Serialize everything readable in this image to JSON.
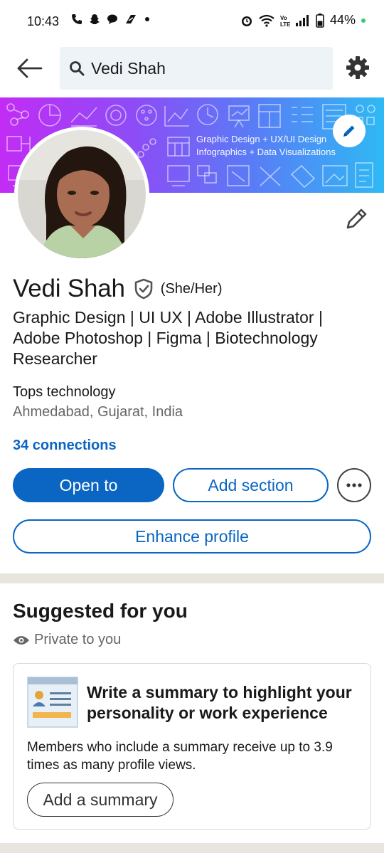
{
  "status_bar": {
    "time": "10:43",
    "battery": "44%"
  },
  "search": {
    "query": "Vedi Shah"
  },
  "banner": {
    "line1": "Graphic Design + UX/UI Design",
    "line2": "Infographics + Data Visualizations"
  },
  "profile": {
    "name": "Vedi Shah",
    "pronouns": "(She/Her)",
    "headline": "Graphic Design | UI UX | Adobe Illustrator | Adobe Photoshop | Figma | Biotechnology Researcher",
    "company": "Tops technology",
    "location": "Ahmedabad, Gujarat, India",
    "connections": "34 connections"
  },
  "actions": {
    "open_to": "Open to",
    "add_section": "Add section",
    "enhance_profile": "Enhance profile"
  },
  "suggested": {
    "title": "Suggested for you",
    "privacy": "Private to you",
    "card_title": "Write a summary to highlight your personality or work experience",
    "card_desc": "Members who include a summary receive up to 3.9 times as many profile views.",
    "card_button": "Add a summary"
  },
  "colors": {
    "brand_blue": "#0a66c2",
    "banner_start": "#c22cf5",
    "banner_end": "#2fb9f4"
  }
}
